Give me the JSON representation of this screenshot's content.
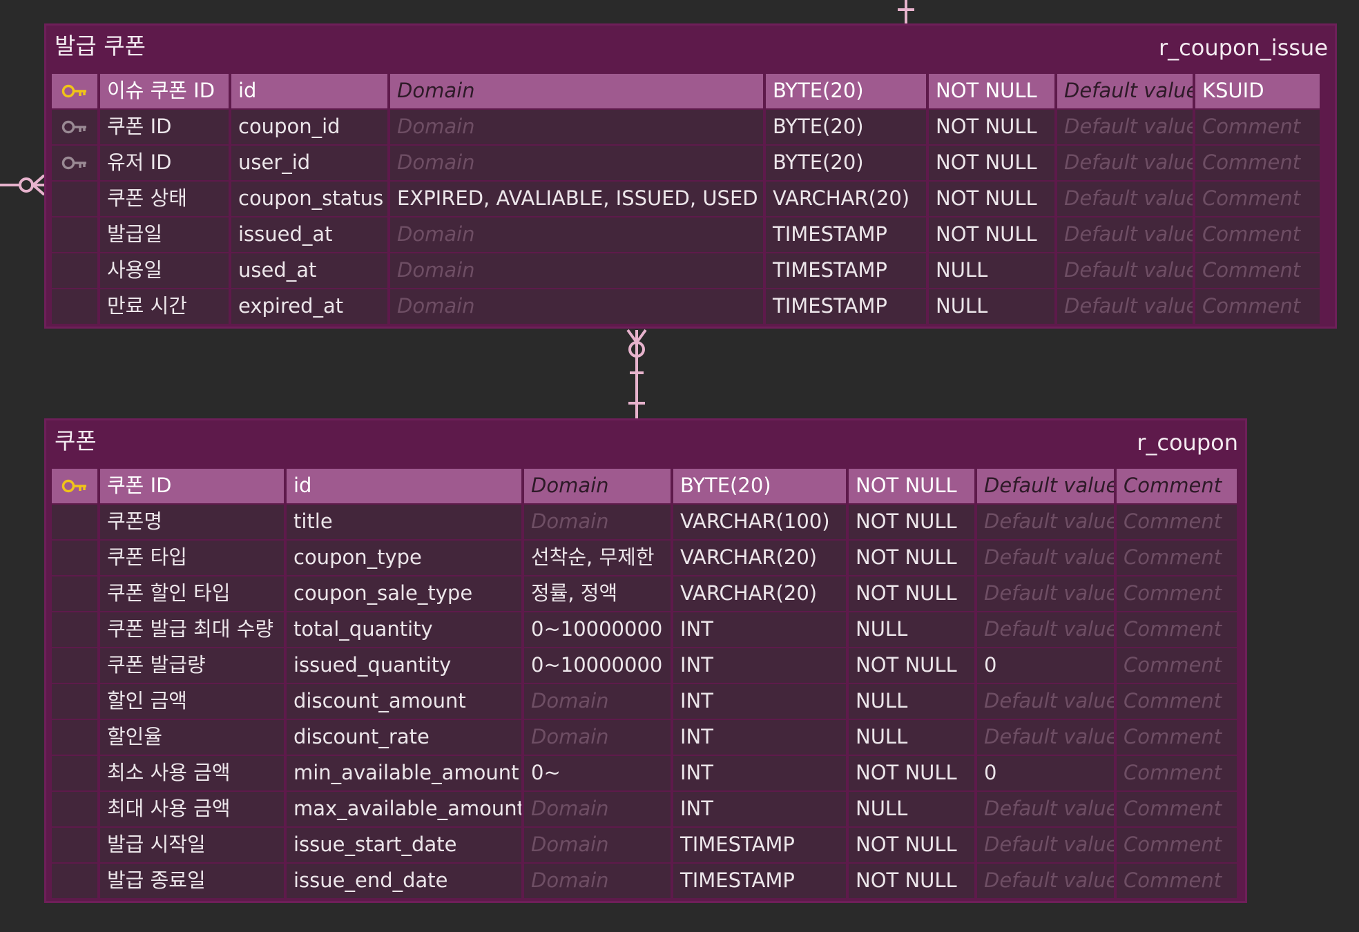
{
  "colors": {
    "background": "#2a2a2a",
    "entity_fill": "#5e1a4b",
    "row_cell": "#43263b",
    "pk_row_cell": "#9f5a8f",
    "connector": "#e7b3cd",
    "pk_key_icon": "#f0c419",
    "fk_key_icon": "#9a8a94"
  },
  "relations": [
    {
      "name": "coupon-to-coupon-issue",
      "from_card": "one",
      "to_card": "zero-or-many"
    }
  ],
  "coupon_issue": {
    "name": "발급 쿠폰",
    "table_name": "r_coupon_issue",
    "rows": [
      {
        "key_icon": "primary-key-icon",
        "label": "이슈 쿠폰 ID",
        "column": "id",
        "domain": "Domain",
        "domain_placeholder": true,
        "type": "BYTE(20)",
        "nullable": "NOT NULL",
        "default": "Default value",
        "default_placeholder": true,
        "comment": "KSUID",
        "comment_placeholder": false
      },
      {
        "key_icon": "foreign-key-icon",
        "label": "쿠폰 ID",
        "column": "coupon_id",
        "domain": "Domain",
        "domain_placeholder": true,
        "type": "BYTE(20)",
        "nullable": "NOT NULL",
        "default": "Default value",
        "default_placeholder": true,
        "comment": "Comment",
        "comment_placeholder": true
      },
      {
        "key_icon": "foreign-key-icon",
        "label": "유저 ID",
        "column": "user_id",
        "domain": "Domain",
        "domain_placeholder": true,
        "type": "BYTE(20)",
        "nullable": "NOT NULL",
        "default": "Default value",
        "default_placeholder": true,
        "comment": "Comment",
        "comment_placeholder": true
      },
      {
        "key_icon": "",
        "label": "쿠폰 상태",
        "column": "coupon_status",
        "domain": "EXPIRED, AVALIABLE, ISSUED, USED",
        "domain_placeholder": false,
        "type": "VARCHAR(20)",
        "nullable": "NOT NULL",
        "default": "Default value",
        "default_placeholder": true,
        "comment": "Comment",
        "comment_placeholder": true
      },
      {
        "key_icon": "",
        "label": "발급일",
        "column": "issued_at",
        "domain": "Domain",
        "domain_placeholder": true,
        "type": "TIMESTAMP",
        "nullable": "NOT NULL",
        "default": "Default value",
        "default_placeholder": true,
        "comment": "Comment",
        "comment_placeholder": true
      },
      {
        "key_icon": "",
        "label": "사용일",
        "column": "used_at",
        "domain": "Domain",
        "domain_placeholder": true,
        "type": "TIMESTAMP",
        "nullable": "NULL",
        "default": "Default value",
        "default_placeholder": true,
        "comment": "Comment",
        "comment_placeholder": true
      },
      {
        "key_icon": "",
        "label": "만료 시간",
        "column": "expired_at",
        "domain": "Domain",
        "domain_placeholder": true,
        "type": "TIMESTAMP",
        "nullable": "NULL",
        "default": "Default value",
        "default_placeholder": true,
        "comment": "Comment",
        "comment_placeholder": true
      }
    ]
  },
  "coupon": {
    "name": "쿠폰",
    "table_name": "r_coupon",
    "rows": [
      {
        "key_icon": "primary-key-icon",
        "label": "쿠폰 ID",
        "column": "id",
        "domain": "Domain",
        "domain_placeholder": true,
        "type": "BYTE(20)",
        "nullable": "NOT NULL",
        "default": "Default value",
        "default_placeholder": true,
        "comment": "Comment",
        "comment_placeholder": true
      },
      {
        "key_icon": "",
        "label": "쿠폰명",
        "column": "title",
        "domain": "Domain",
        "domain_placeholder": true,
        "type": "VARCHAR(100)",
        "nullable": "NOT NULL",
        "default": "Default value",
        "default_placeholder": true,
        "comment": "Comment",
        "comment_placeholder": true
      },
      {
        "key_icon": "",
        "label": "쿠폰 타입",
        "column": "coupon_type",
        "domain": "선착순, 무제한",
        "domain_placeholder": false,
        "type": "VARCHAR(20)",
        "nullable": "NOT NULL",
        "default": "Default value",
        "default_placeholder": true,
        "comment": "Comment",
        "comment_placeholder": true
      },
      {
        "key_icon": "",
        "label": "쿠폰 할인 타입",
        "column": "coupon_sale_type",
        "domain": "정률, 정액",
        "domain_placeholder": false,
        "type": "VARCHAR(20)",
        "nullable": "NOT NULL",
        "default": "Default value",
        "default_placeholder": true,
        "comment": "Comment",
        "comment_placeholder": true
      },
      {
        "key_icon": "",
        "label": "쿠폰 발급 최대 수량",
        "column": "total_quantity",
        "domain": "0~10000000",
        "domain_placeholder": false,
        "type": "INT",
        "nullable": "NULL",
        "default": "Default value",
        "default_placeholder": true,
        "comment": "Comment",
        "comment_placeholder": true
      },
      {
        "key_icon": "",
        "label": "쿠폰 발급량",
        "column": "issued_quantity",
        "domain": "0~10000000",
        "domain_placeholder": false,
        "type": "INT",
        "nullable": "NOT NULL",
        "default": "0",
        "default_placeholder": false,
        "comment": "Comment",
        "comment_placeholder": true
      },
      {
        "key_icon": "",
        "label": "할인 금액",
        "column": "discount_amount",
        "domain": "Domain",
        "domain_placeholder": true,
        "type": "INT",
        "nullable": "NULL",
        "default": "Default value",
        "default_placeholder": true,
        "comment": "Comment",
        "comment_placeholder": true
      },
      {
        "key_icon": "",
        "label": "할인율",
        "column": "discount_rate",
        "domain": "Domain",
        "domain_placeholder": true,
        "type": "INT",
        "nullable": "NULL",
        "default": "Default value",
        "default_placeholder": true,
        "comment": "Comment",
        "comment_placeholder": true
      },
      {
        "key_icon": "",
        "label": "최소 사용 금액",
        "column": "min_available_amount",
        "domain": "0~",
        "domain_placeholder": false,
        "type": "INT",
        "nullable": "NOT NULL",
        "default": "0",
        "default_placeholder": false,
        "comment": "Comment",
        "comment_placeholder": true
      },
      {
        "key_icon": "",
        "label": "최대 사용 금액",
        "column": "max_available_amount",
        "domain": "Domain",
        "domain_placeholder": true,
        "type": "INT",
        "nullable": "NULL",
        "default": "Default value",
        "default_placeholder": true,
        "comment": "Comment",
        "comment_placeholder": true
      },
      {
        "key_icon": "",
        "label": "발급 시작일",
        "column": "issue_start_date",
        "domain": "Domain",
        "domain_placeholder": true,
        "type": "TIMESTAMP",
        "nullable": "NOT NULL",
        "default": "Default value",
        "default_placeholder": true,
        "comment": "Comment",
        "comment_placeholder": true
      },
      {
        "key_icon": "",
        "label": "발급 종료일",
        "column": "issue_end_date",
        "domain": "Domain",
        "domain_placeholder": true,
        "type": "TIMESTAMP",
        "nullable": "NOT NULL",
        "default": "Default value",
        "default_placeholder": true,
        "comment": "Comment",
        "comment_placeholder": true
      }
    ]
  }
}
